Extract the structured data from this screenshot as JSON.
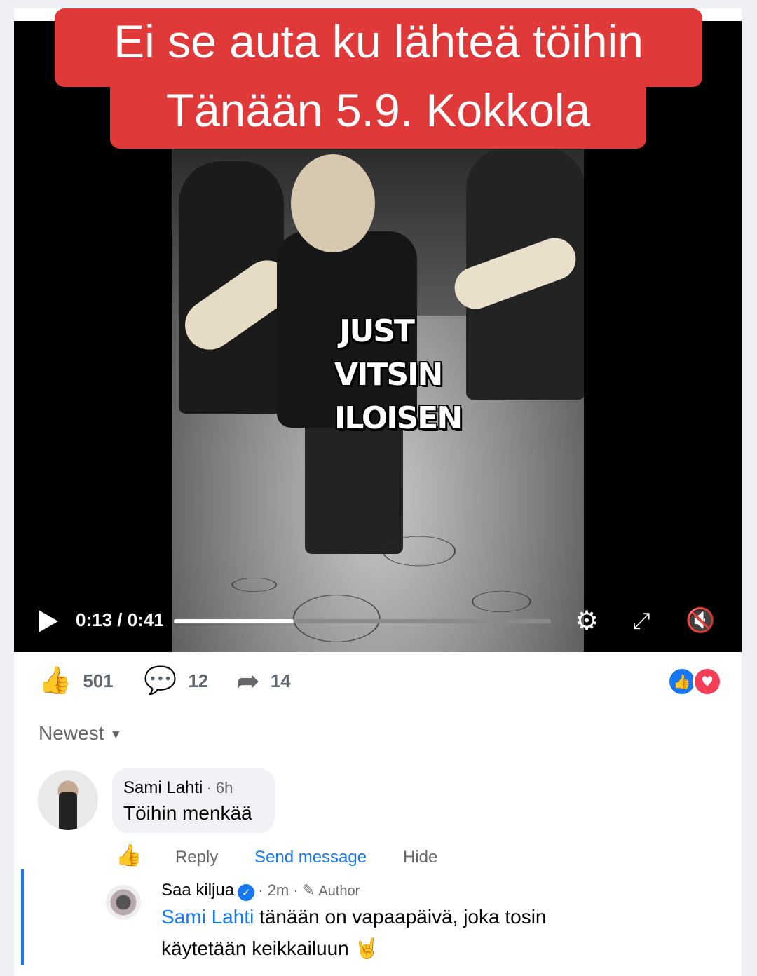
{
  "banner": {
    "line1": "Ei se auta ku lähteä töihin",
    "line2": "Tänään 5.9. Kokkola"
  },
  "video": {
    "overlay_lines": [
      "JUST",
      "VITSIN",
      "ILOISEN"
    ],
    "time": "0:13 / 0:41",
    "progress": 0.317
  },
  "stats": {
    "likes": "501",
    "comments": "12",
    "shares": "14"
  },
  "sort": {
    "label": "Newest"
  },
  "comment1": {
    "author": "Sami Lahti",
    "time": "· 6h",
    "text": "Töihin menkää"
  },
  "actions": {
    "reply": "Reply",
    "send_message": "Send message",
    "hide": "Hide"
  },
  "comment2": {
    "author": "Saa kiljua",
    "time": "· 2m ·",
    "badge": "Author",
    "mention": "Sami Lahti",
    "text_line1": " tänään on vapaapäivä, joka tosin",
    "text_line2": "käytetään keikkailuun 🤘"
  },
  "colors": {
    "banner_red": "#e0393a",
    "link_blue": "#1877f2",
    "muted": "#65676b"
  }
}
